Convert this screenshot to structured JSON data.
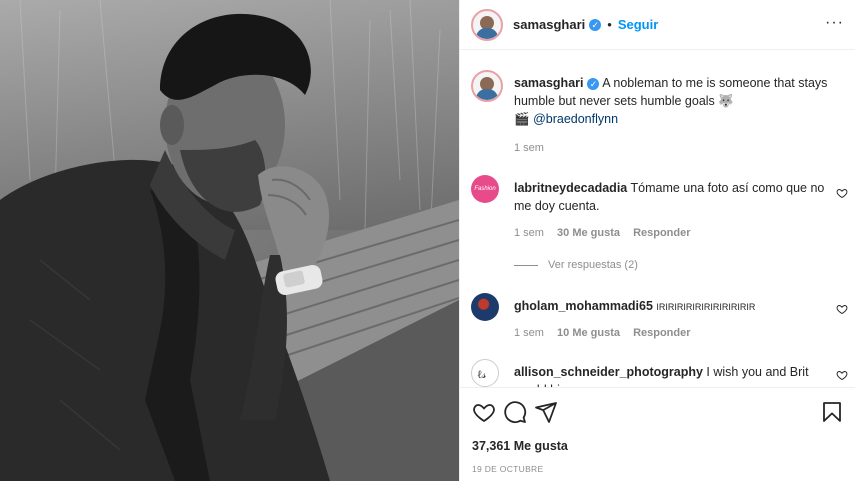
{
  "post": {
    "author": "samasghari",
    "follow_label": "Seguir",
    "dot": "•",
    "more_label": "···"
  },
  "caption": {
    "username": "samasghari",
    "text": "A nobleman to me is someone that stays humble but never sets humble goals 🐺",
    "credit_emoji": "🎬",
    "credit_mention": "@braedonflynn",
    "time": "1 sem"
  },
  "comments": [
    {
      "username": "labritneydecadadia",
      "avatar_text": "Fashion",
      "text": "Tómame una foto así como que no me doy cuenta.",
      "time": "1 sem",
      "likes": "30 Me gusta",
      "reply_label": "Responder",
      "view_replies": "Ver respuestas (2)"
    },
    {
      "username": "gholam_mohammadi65",
      "text": "IRIRIRIRIRIRIRIRIRIRIR",
      "time": "1 sem",
      "likes": "10 Me gusta",
      "reply_label": "Responder"
    },
    {
      "username": "allison_schneider_photography",
      "text": "I wish you and Brit would hire"
    }
  ],
  "actions": {
    "like_count": "37,361 Me gusta",
    "date": "19 DE OCTUBRE"
  },
  "colors": {
    "accent": "#0095f6",
    "verified": "#3897f0",
    "muted": "#8e8e8e",
    "text": "#262626"
  }
}
